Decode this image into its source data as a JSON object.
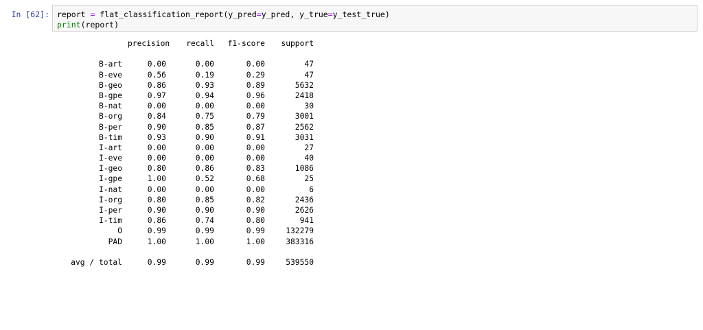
{
  "prompt": "In [62]:",
  "code": {
    "line1": {
      "var": "report",
      "eq": "=",
      "fn": "flat_classification_report(y_pred",
      "eq2": "=",
      "mid": "y_pred, y_true",
      "eq3": "=",
      "end": "y_test_true)"
    },
    "line2": {
      "fn": "print",
      "arg": "(report)"
    }
  },
  "report": {
    "headers": [
      "precision",
      "recall",
      "f1-score",
      "support"
    ],
    "rows": [
      {
        "label": "B-art",
        "precision": "0.00",
        "recall": "0.00",
        "f1": "0.00",
        "support": "47"
      },
      {
        "label": "B-eve",
        "precision": "0.56",
        "recall": "0.19",
        "f1": "0.29",
        "support": "47"
      },
      {
        "label": "B-geo",
        "precision": "0.86",
        "recall": "0.93",
        "f1": "0.89",
        "support": "5632"
      },
      {
        "label": "B-gpe",
        "precision": "0.97",
        "recall": "0.94",
        "f1": "0.96",
        "support": "2418"
      },
      {
        "label": "B-nat",
        "precision": "0.00",
        "recall": "0.00",
        "f1": "0.00",
        "support": "30"
      },
      {
        "label": "B-org",
        "precision": "0.84",
        "recall": "0.75",
        "f1": "0.79",
        "support": "3001"
      },
      {
        "label": "B-per",
        "precision": "0.90",
        "recall": "0.85",
        "f1": "0.87",
        "support": "2562"
      },
      {
        "label": "B-tim",
        "precision": "0.93",
        "recall": "0.90",
        "f1": "0.91",
        "support": "3031"
      },
      {
        "label": "I-art",
        "precision": "0.00",
        "recall": "0.00",
        "f1": "0.00",
        "support": "27"
      },
      {
        "label": "I-eve",
        "precision": "0.00",
        "recall": "0.00",
        "f1": "0.00",
        "support": "40"
      },
      {
        "label": "I-geo",
        "precision": "0.80",
        "recall": "0.86",
        "f1": "0.83",
        "support": "1086"
      },
      {
        "label": "I-gpe",
        "precision": "1.00",
        "recall": "0.52",
        "f1": "0.68",
        "support": "25"
      },
      {
        "label": "I-nat",
        "precision": "0.00",
        "recall": "0.00",
        "f1": "0.00",
        "support": "6"
      },
      {
        "label": "I-org",
        "precision": "0.80",
        "recall": "0.85",
        "f1": "0.82",
        "support": "2436"
      },
      {
        "label": "I-per",
        "precision": "0.90",
        "recall": "0.90",
        "f1": "0.90",
        "support": "2626"
      },
      {
        "label": "I-tim",
        "precision": "0.86",
        "recall": "0.74",
        "f1": "0.80",
        "support": "941"
      },
      {
        "label": "O",
        "precision": "0.99",
        "recall": "0.99",
        "f1": "0.99",
        "support": "132279"
      },
      {
        "label": "PAD",
        "precision": "1.00",
        "recall": "1.00",
        "f1": "1.00",
        "support": "383316"
      }
    ],
    "total": {
      "label": "avg / total",
      "precision": "0.99",
      "recall": "0.99",
      "f1": "0.99",
      "support": "539550"
    }
  }
}
